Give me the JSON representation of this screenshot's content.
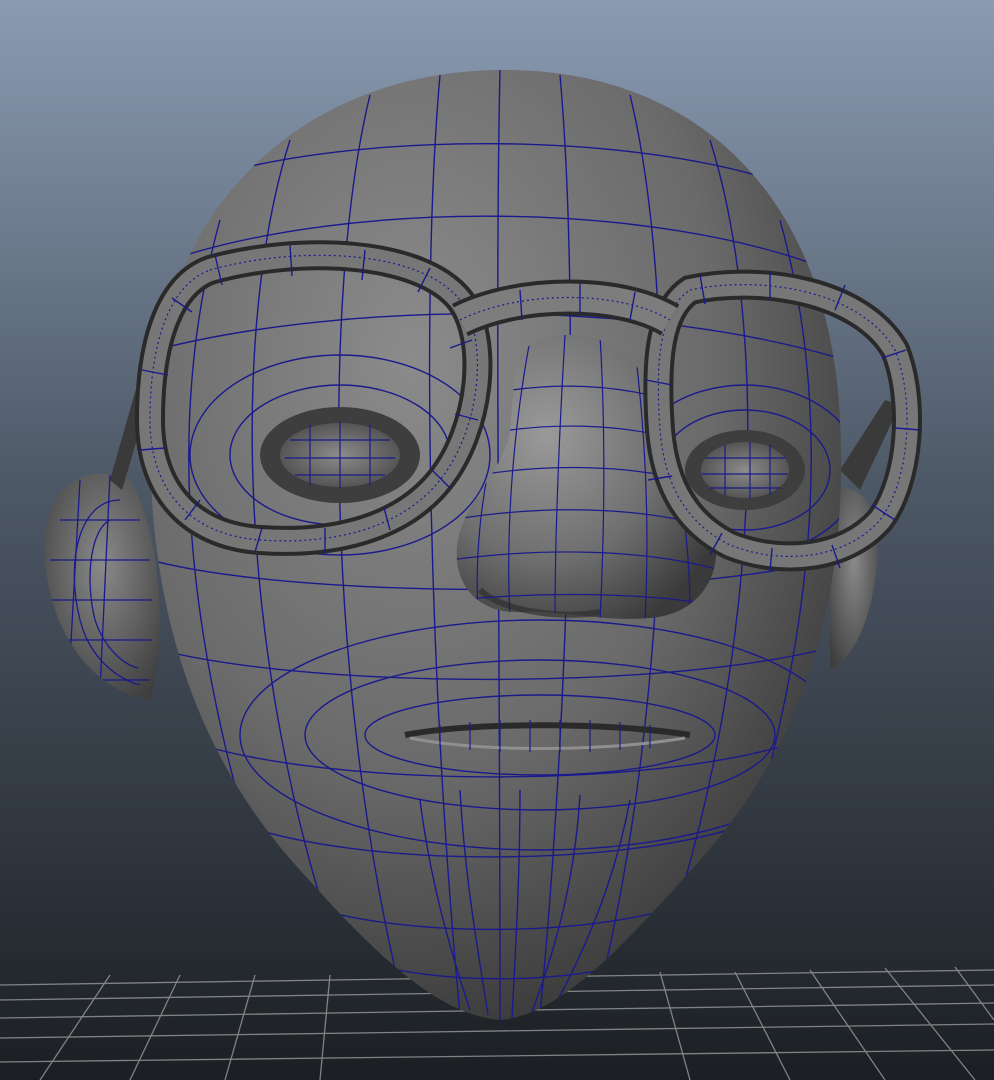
{
  "viewport": {
    "background_top": "#8a9bb2",
    "background_bottom": "#1b1f23",
    "wireframe_color": "#1a1a8c",
    "shaded_color": "#7a7a7a",
    "grid_color": "#9a9a9a"
  },
  "scene": {
    "objects": [
      {
        "name": "head",
        "icon": "mesh-head"
      },
      {
        "name": "glasses",
        "icon": "mesh-glasses"
      },
      {
        "name": "ground-grid",
        "icon": "grid"
      }
    ]
  }
}
